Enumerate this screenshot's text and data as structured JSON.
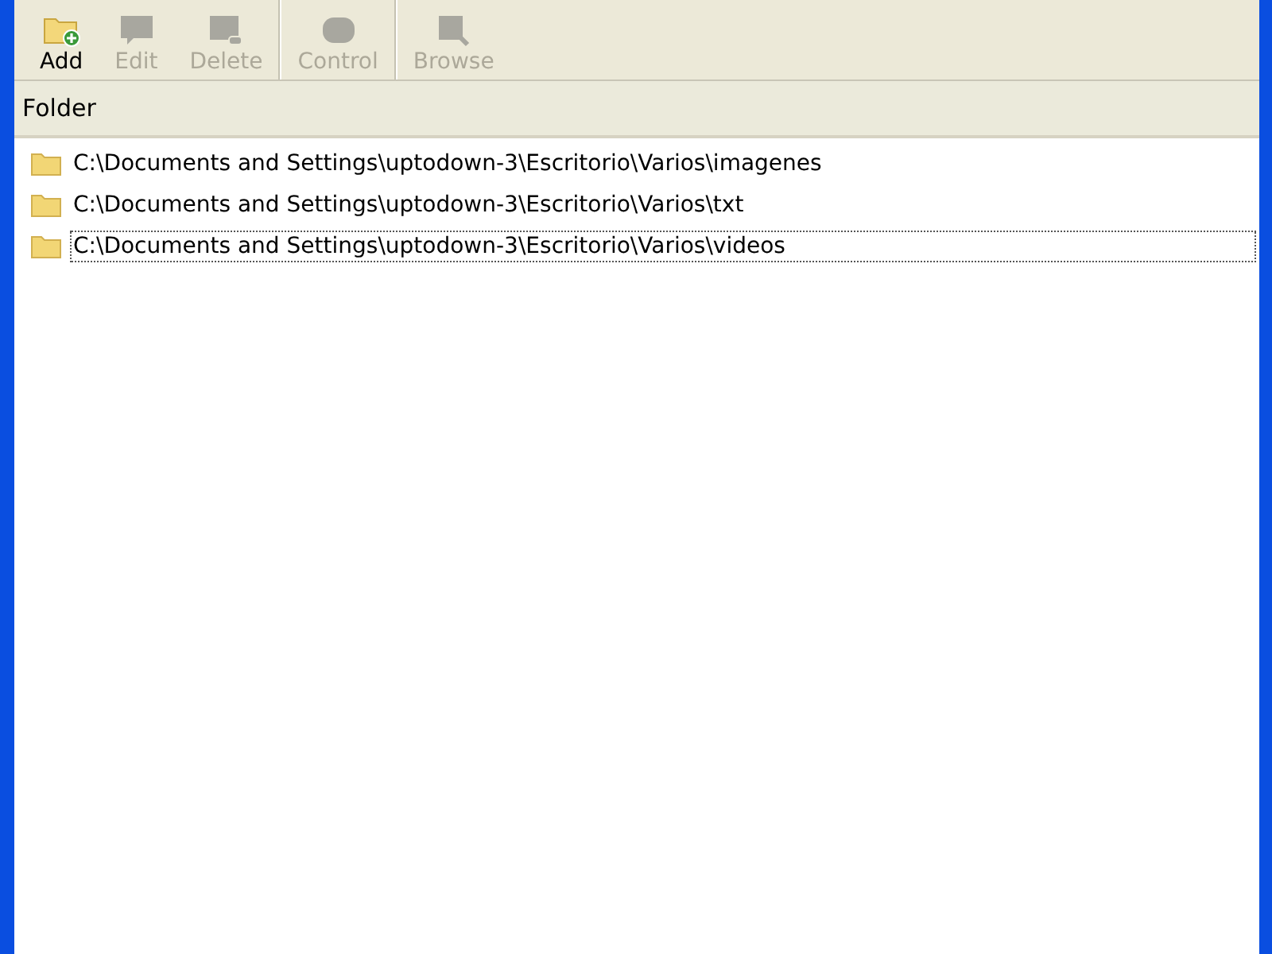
{
  "toolbar": [
    {
      "kind": "add",
      "label": "Add",
      "disabled": false,
      "separator_after": false
    },
    {
      "kind": "edit",
      "label": "Edit",
      "disabled": true,
      "separator_after": false
    },
    {
      "kind": "delete",
      "label": "Delete",
      "disabled": true,
      "separator_after": true
    },
    {
      "kind": "control",
      "label": "Control",
      "disabled": true,
      "separator_after": true
    },
    {
      "kind": "browse",
      "label": "Browse",
      "disabled": true,
      "separator_after": false
    }
  ],
  "list": {
    "columns": [
      "Folder"
    ],
    "rows": [
      {
        "path": "C:\\Documents and Settings\\uptodown-3\\Escritorio\\Varios\\imagenes",
        "focused": false
      },
      {
        "path": "C:\\Documents and Settings\\uptodown-3\\Escritorio\\Varios\\txt",
        "focused": false
      },
      {
        "path": "C:\\Documents and Settings\\uptodown-3\\Escritorio\\Varios\\videos",
        "focused": true
      }
    ]
  }
}
